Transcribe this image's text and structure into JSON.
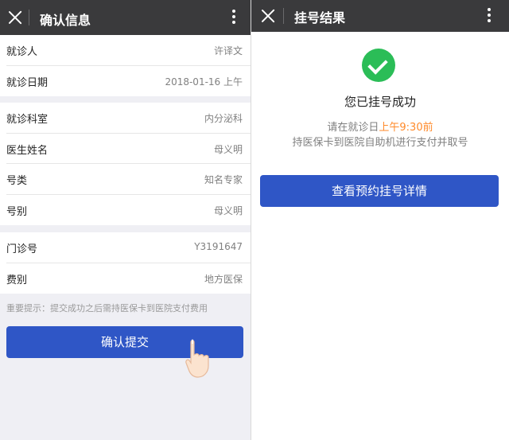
{
  "left": {
    "title": "确认信息",
    "group1": [
      {
        "label": "就诊人",
        "value": "许译文"
      },
      {
        "label": "就诊日期",
        "value": "2018-01-16 上午"
      }
    ],
    "group2": [
      {
        "label": "就诊科室",
        "value": "内分泌科"
      },
      {
        "label": "医生姓名",
        "value": "母义明"
      },
      {
        "label": "号类",
        "value": "知名专家"
      },
      {
        "label": "号别",
        "value": "母义明"
      }
    ],
    "group3": [
      {
        "label": "门诊号",
        "value": "Y3191647"
      },
      {
        "label": "费别",
        "value": "地方医保"
      }
    ],
    "tip": "重要提示：提交成功之后需持医保卡到医院支付费用",
    "submit_label": "确认提交"
  },
  "right": {
    "title": "挂号结果",
    "success_title": "您已挂号成功",
    "line1_prefix": "请在就诊日",
    "line1_highlight": "上午9:30前",
    "line2": "持医保卡到医院自助机进行支付并取号",
    "detail_button": "查看预约挂号详情"
  },
  "colors": {
    "topbar": "#3a3a3c",
    "primary_button": "#2f56c6",
    "success": "#2bbd57",
    "highlight": "#ff8a2a"
  },
  "icons": {
    "close": "close-icon",
    "more": "more-vertical-icon",
    "success": "check-circle-icon",
    "hand": "pointing-hand-icon"
  }
}
